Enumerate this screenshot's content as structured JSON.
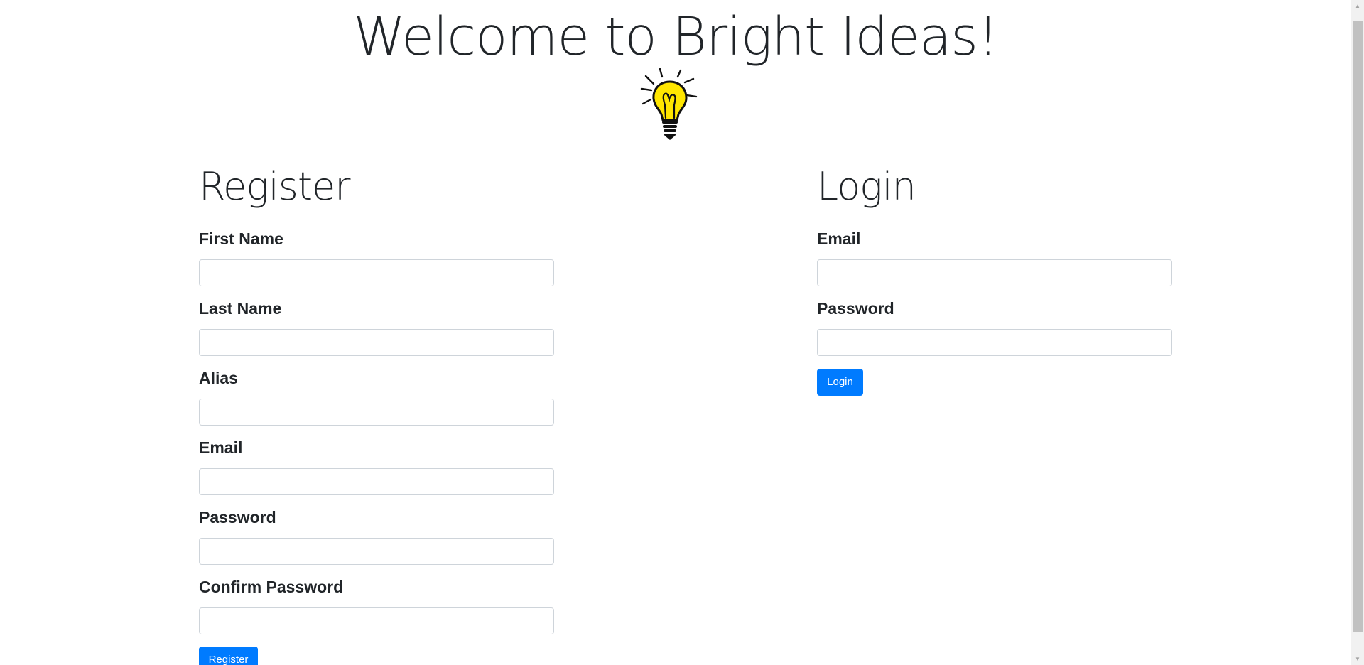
{
  "header": {
    "title": "Welcome to Bright Ideas!",
    "logo_icon": "lightbulb-icon"
  },
  "register": {
    "title": "Register",
    "fields": [
      {
        "label": "First Name",
        "value": ""
      },
      {
        "label": "Last Name",
        "value": ""
      },
      {
        "label": "Alias",
        "value": ""
      },
      {
        "label": "Email",
        "value": ""
      },
      {
        "label": "Password",
        "value": ""
      },
      {
        "label": "Confirm Password",
        "value": ""
      }
    ],
    "button_label": "Register"
  },
  "login": {
    "title": "Login",
    "fields": [
      {
        "label": "Email",
        "value": ""
      },
      {
        "label": "Password",
        "value": ""
      }
    ],
    "button_label": "Login"
  },
  "colors": {
    "primary_button": "#007bff",
    "text": "#212529",
    "input_border": "#ced4da",
    "bulb_yellow": "#ffe600"
  }
}
